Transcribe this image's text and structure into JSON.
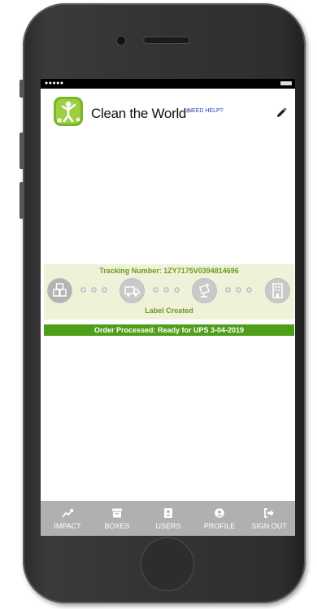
{
  "header": {
    "brand": "Clean the World",
    "brand_mark": "®",
    "help_link": "NEED HELP?"
  },
  "tracking": {
    "tracking_number_text": "Tracking Number: 1ZY7175V0394814696",
    "steps": [
      {
        "icon": "boxes-icon",
        "active": true
      },
      {
        "icon": "truck-icon",
        "active": false
      },
      {
        "icon": "package-scan-icon",
        "active": false
      },
      {
        "icon": "building-icon",
        "active": false
      }
    ],
    "status_label": "Label Created",
    "order_status": "Order Processed: Ready for UPS 3-04-2019"
  },
  "nav": {
    "items": [
      {
        "label": "IMPACT",
        "icon": "chart-trend-icon"
      },
      {
        "label": "BOXES",
        "icon": "archive-box-icon"
      },
      {
        "label": "USERS",
        "icon": "address-book-icon"
      },
      {
        "label": "PROFILE",
        "icon": "user-circle-icon"
      },
      {
        "label": "SIGN OUT",
        "icon": "sign-out-icon"
      }
    ]
  },
  "colors": {
    "brand_green": "#6a9a1a",
    "status_bar_green": "#4e9e1a",
    "tracking_bg": "#eff2d9",
    "nav_bg": "#b0b0b0",
    "help_link": "#2a3fb5"
  }
}
